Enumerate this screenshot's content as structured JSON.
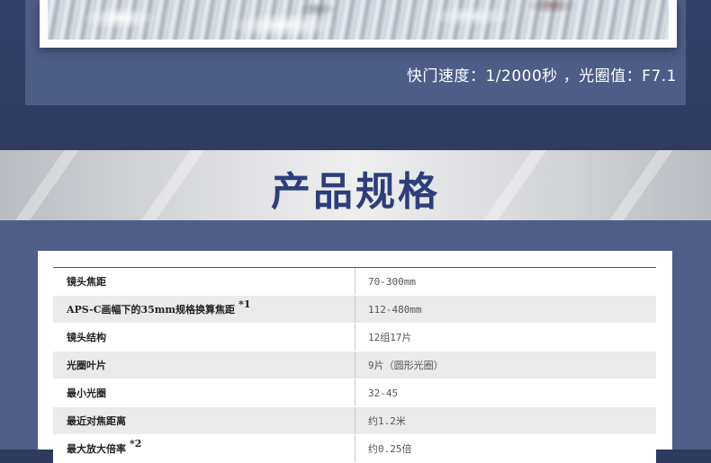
{
  "photo": {
    "caption": "快门速度：1/2000秒 ，光圈值：F7.1"
  },
  "section": {
    "title": "产品规格"
  },
  "specs": {
    "rows": [
      {
        "label": "镜头焦距",
        "note": "",
        "value": "70-300mm"
      },
      {
        "label": "APS-C画幅下的35mm规格换算焦距",
        "note": "*1",
        "value": "112-480mm"
      },
      {
        "label": "镜头结构",
        "note": "",
        "value": "12组17片"
      },
      {
        "label": "光圈叶片",
        "note": "",
        "value": "9片（圆形光圈）"
      },
      {
        "label": "最小光圈",
        "note": "",
        "value": "32-45"
      },
      {
        "label": "最近对焦距离",
        "note": "",
        "value": "约1.2米"
      },
      {
        "label": "最大放大倍率",
        "note": "*2",
        "value": "约0.25倍"
      }
    ]
  },
  "colors": {
    "title": "#2d3f7a",
    "page_bg": "#2e3a5e",
    "panel_bg": "#4f5d88",
    "table_top_rule": "#7a3a3a"
  }
}
